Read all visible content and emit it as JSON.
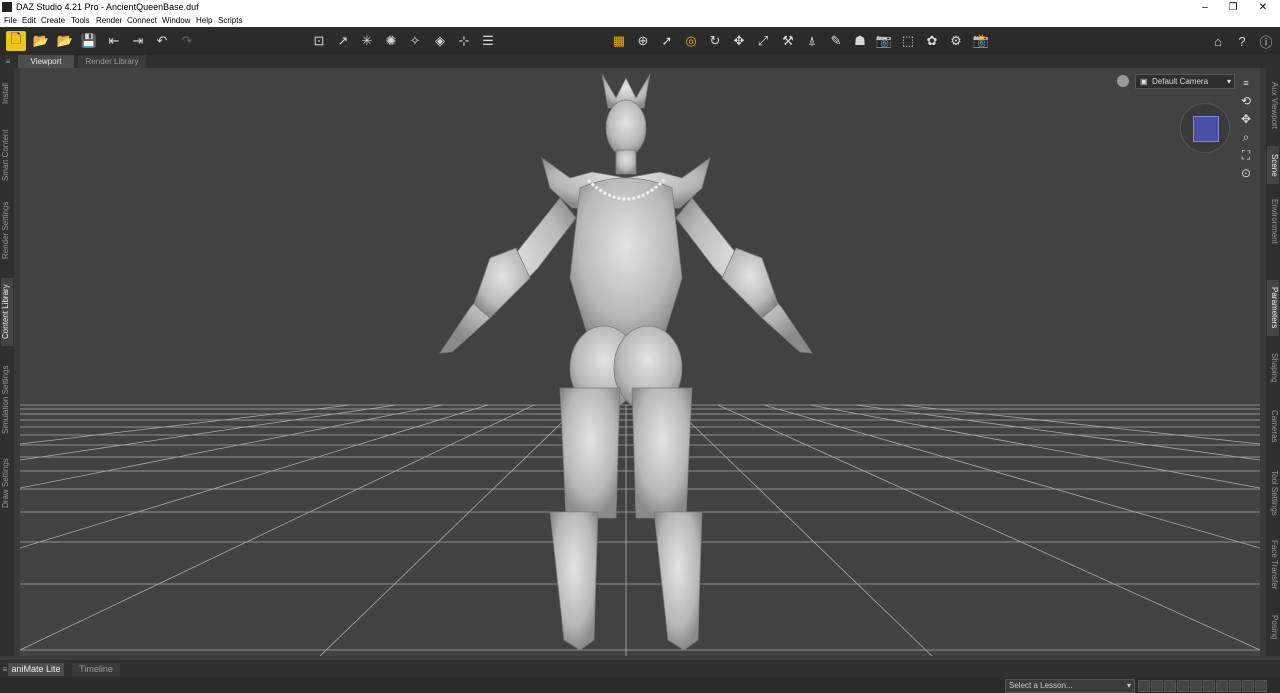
{
  "window": {
    "title": "DAZ Studio 4.21 Pro - AncientQueenBase.duf"
  },
  "menu": [
    "File",
    "Edit",
    "Create",
    "Tools",
    "Render",
    "Connect",
    "Window",
    "Help",
    "Scripts"
  ],
  "top_tabs": [
    "Viewport",
    "Render Library"
  ],
  "left_tabs": [
    "Install",
    "Smart Content",
    "Render Settings",
    "Content Library",
    "Simulation Settings",
    "Draw Settings"
  ],
  "right_tabs": [
    "Aux Viewport",
    "Scene",
    "Environment",
    "Parameters",
    "Shaping",
    "Cameras",
    "Tool Settings",
    "Face Transfer",
    "Posing"
  ],
  "camera": {
    "selected": "Default Camera"
  },
  "bottom_tabs": [
    "aniMate Lite",
    "Timeline"
  ],
  "status": {
    "lesson_placeholder": "Select a Lesson..."
  },
  "accent": "#f0c419"
}
